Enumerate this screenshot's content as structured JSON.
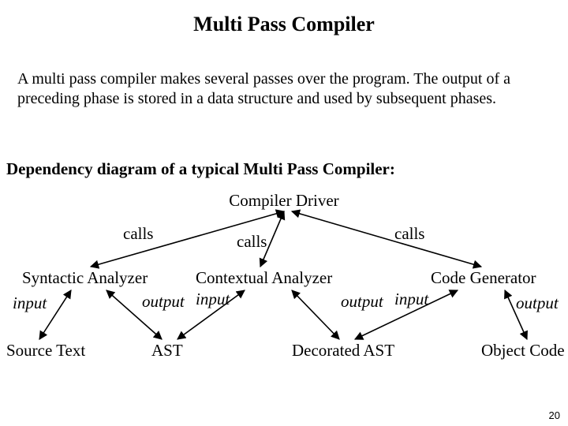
{
  "title": "Multi Pass Compiler",
  "intro": "A multi pass compiler makes several passes over the program. The output of a preceding phase is stored in a data structure and used by subsequent phases.",
  "dep_heading": "Dependency diagram of a typical Multi Pass Compiler:",
  "driver": "Compiler Driver",
  "calls": {
    "left": "calls",
    "mid": "calls",
    "right": "calls"
  },
  "phases": {
    "syntactic": "Syntactic Analyzer",
    "contextual": "Contextual Analyzer",
    "codegen": "Code Generator"
  },
  "io": {
    "input1": "input",
    "output1": "output",
    "input2": "input",
    "output2": "output",
    "input3": "input",
    "output3": "output"
  },
  "artifacts": {
    "source": "Source Text",
    "ast": "AST",
    "decorated_ast": "Decorated AST",
    "object_code": "Object Code"
  },
  "page_number": "20"
}
